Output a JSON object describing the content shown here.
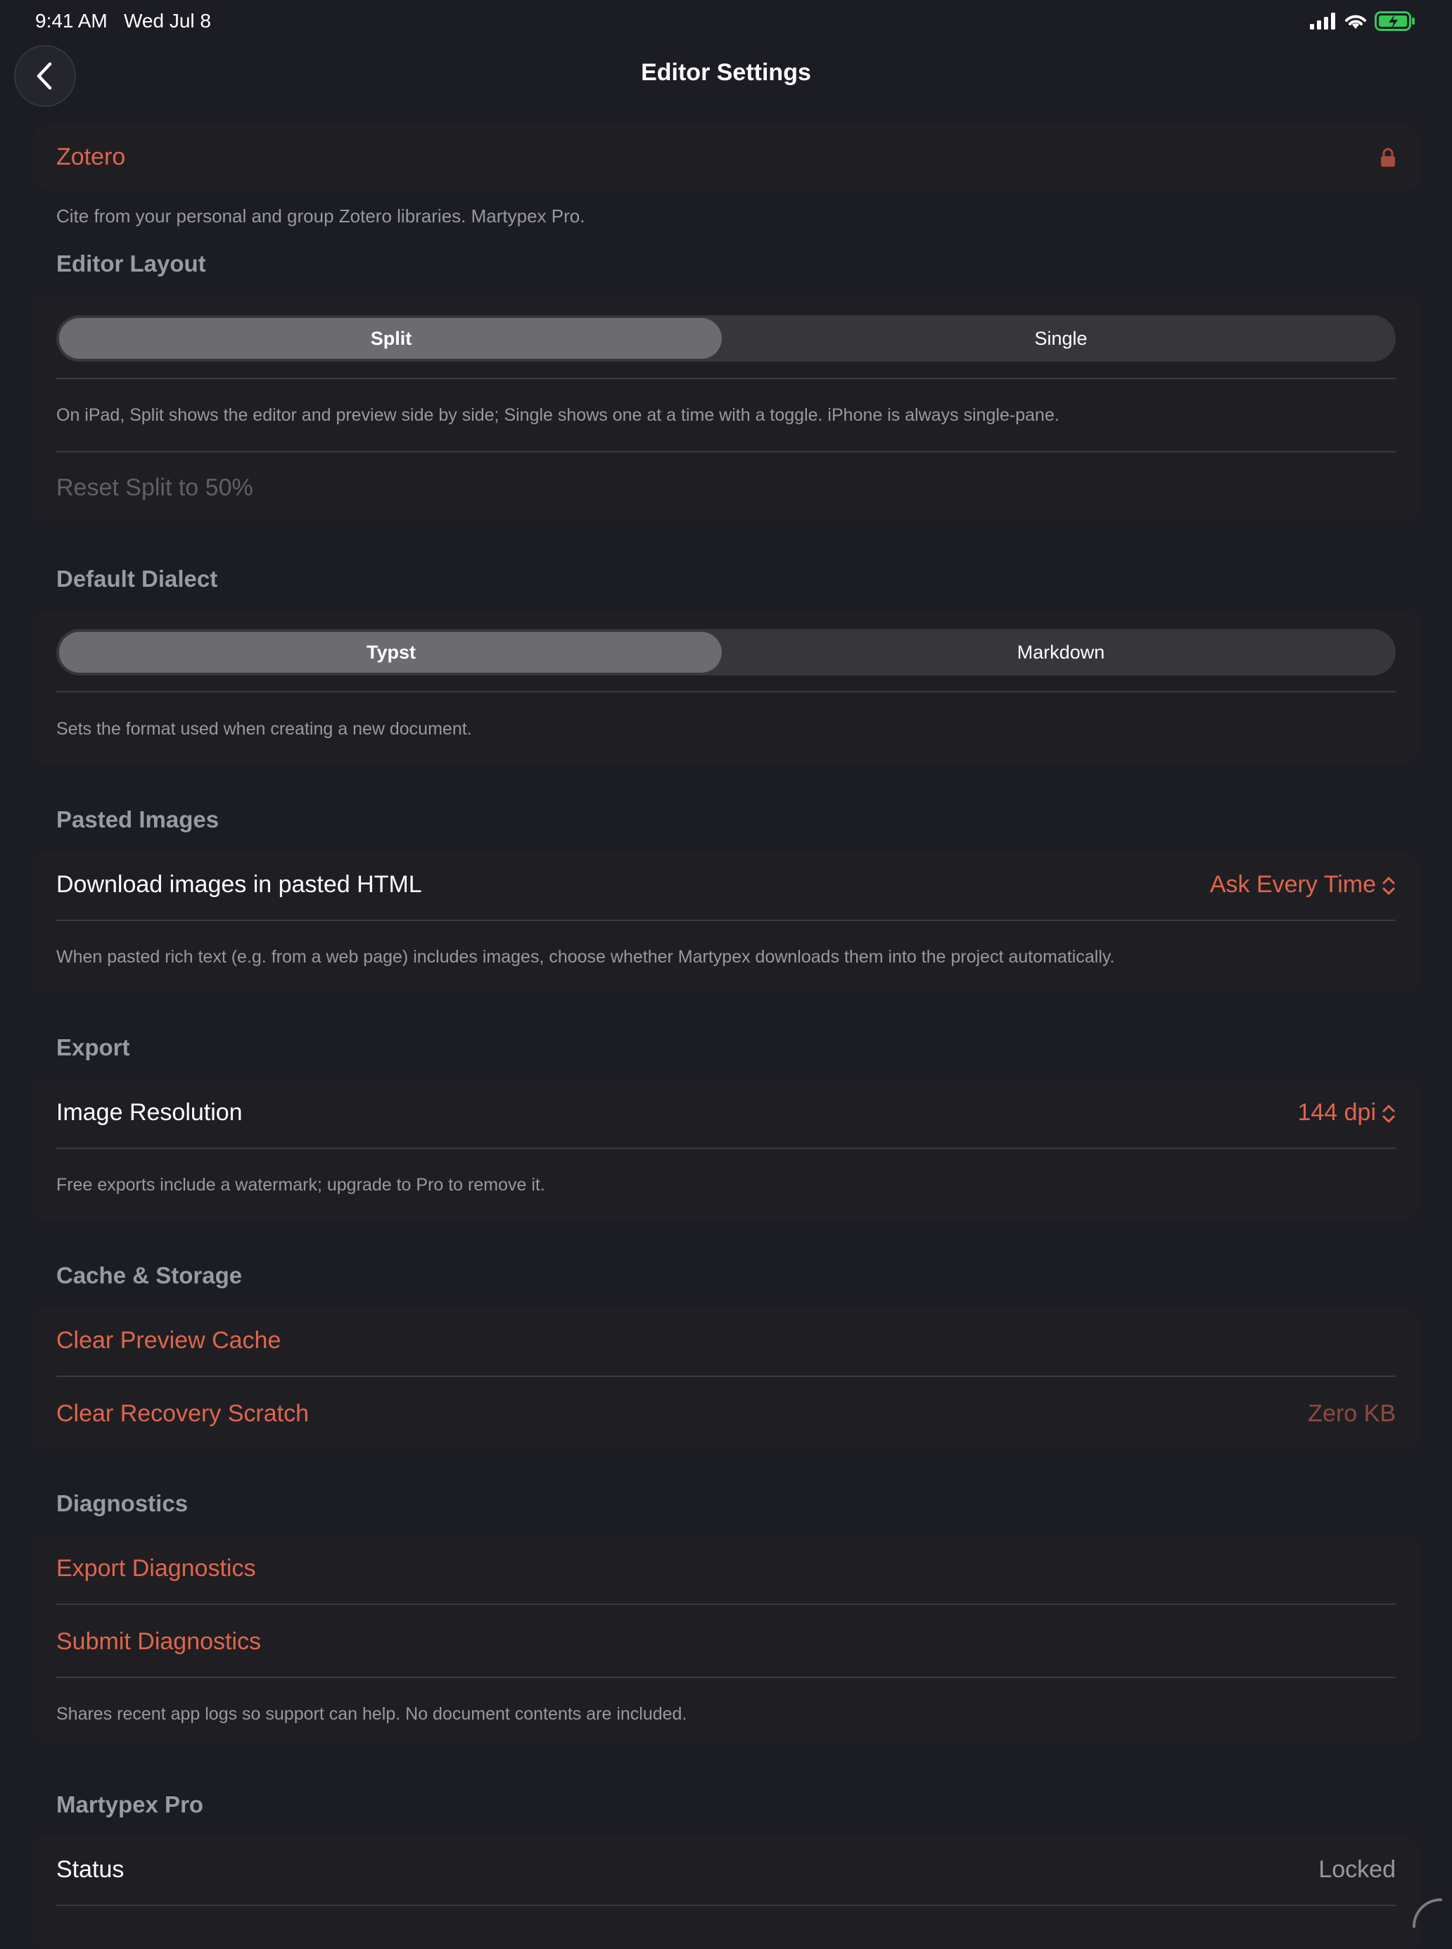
{
  "status_bar": {
    "time": "9:41 AM",
    "date": "Wed Jul 8"
  },
  "nav": {
    "title": "Editor Settings"
  },
  "zotero": {
    "label": "Zotero",
    "footnote": "Cite from your personal and group Zotero libraries. Martypex Pro."
  },
  "editor_layout": {
    "header": "Editor Layout",
    "segments": [
      "Split",
      "Single"
    ],
    "selected": "Split",
    "footnote": "On iPad, Split shows the editor and preview side by side; Single shows one at a time with a toggle. iPhone is always single-pane.",
    "reset_label": "Reset Split to 50%"
  },
  "default_dialect": {
    "header": "Default Dialect",
    "segments": [
      "Typst",
      "Markdown"
    ],
    "selected": "Typst",
    "footnote": "Sets the format used when creating a new document."
  },
  "pasted_images": {
    "header": "Pasted Images",
    "row_label": "Download images in pasted HTML",
    "value": "Ask Every Time",
    "footnote": "When pasted rich text (e.g. from a web page) includes images, choose whether Martypex downloads them into the project automatically."
  },
  "export": {
    "header": "Export",
    "row_label": "Image Resolution",
    "value": "144 dpi",
    "footnote": "Free exports include a watermark; upgrade to Pro to remove it."
  },
  "cache_storage": {
    "header": "Cache & Storage",
    "clear_preview": "Clear Preview Cache",
    "clear_recovery": "Clear Recovery Scratch",
    "recovery_size": "Zero KB"
  },
  "diagnostics": {
    "header": "Diagnostics",
    "export_label": "Export Diagnostics",
    "submit_label": "Submit Diagnostics",
    "footnote": "Shares recent app logs so support can help. No document contents are included."
  },
  "pro": {
    "header": "Martypex Pro",
    "status_label": "Status",
    "status_value": "Locked"
  },
  "colors": {
    "accent": "#e0654b",
    "background": "#1c1c24",
    "card": "#1f1f23",
    "battery": "#34c759"
  }
}
